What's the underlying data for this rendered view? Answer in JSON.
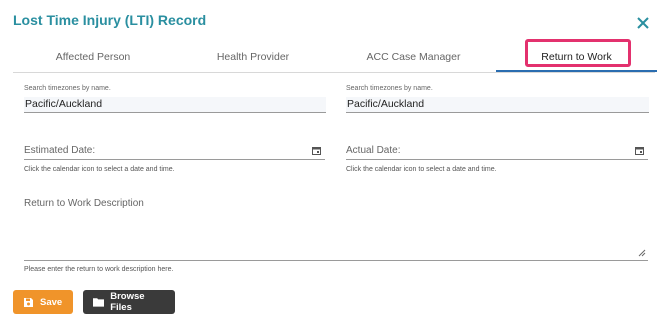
{
  "dialog": {
    "title": "Lost Time Injury (LTI) Record"
  },
  "tabs": [
    {
      "label": "Affected Person"
    },
    {
      "label": "Health Provider"
    },
    {
      "label": "ACC Case Manager"
    },
    {
      "label": "Return to Work"
    }
  ],
  "active_tab": "Return to Work",
  "timezone_left": {
    "caption": "Search timezones by name.",
    "value": "Pacific/Auckland"
  },
  "timezone_right": {
    "caption": "Search timezones by name.",
    "value": "Pacific/Auckland"
  },
  "estimated_date": {
    "label": "Estimated Date:",
    "hint": "Click the calendar icon to select a date and time."
  },
  "actual_date": {
    "label": "Actual Date:",
    "hint": "Click the calendar icon to select a date and time."
  },
  "description": {
    "label": "Return to Work Description",
    "hint": "Please enter the return to work description here."
  },
  "buttons": {
    "save": "Save",
    "browse": "Browse Files"
  },
  "colors": {
    "title": "#2a8fa0",
    "save": "#f0942a",
    "browse": "#3a3a3a",
    "highlight": "#e3316e"
  }
}
